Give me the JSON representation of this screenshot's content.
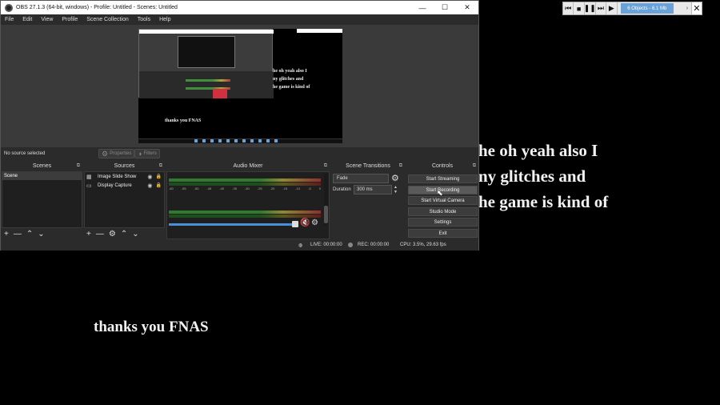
{
  "background": {
    "line1": "he oh yeah also I",
    "line2": "ny glitches and",
    "line3": "he game is kind of",
    "thanks": "thanks you FNAS"
  },
  "media_control": {
    "info": "6 Objects - 6.1 Mb"
  },
  "window": {
    "title": "OBS 27.1.3 (64-bit, windows) - Profile: Untitled - Scenes: Untitled"
  },
  "menu": [
    "File",
    "Edit",
    "View",
    "Profile",
    "Scene Collection",
    "Tools",
    "Help"
  ],
  "preview": {
    "line1": "he oh yeah also I",
    "line2": "ny glitches and",
    "line3": "he game is kind of",
    "thanks": "thanks you FNAS"
  },
  "source_bar": {
    "no_source": "No source selected",
    "properties": "Properties",
    "filters": "Filters"
  },
  "docks": {
    "scenes": "Scenes",
    "sources": "Sources",
    "audio_mixer": "Audio Mixer",
    "scene_transitions": "Scene Transitions",
    "controls": "Controls"
  },
  "scenes": [
    {
      "name": "Scene"
    }
  ],
  "sources": [
    {
      "name": "Image Slide Show"
    },
    {
      "name": "Display Capture"
    }
  ],
  "mixer": {
    "ticks": [
      "-60",
      "-55",
      "-50",
      "-45",
      "-40",
      "-35",
      "-30",
      "-25",
      "-20",
      "-15",
      "-10",
      "-5",
      "0"
    ]
  },
  "transitions": {
    "selected": "Fade",
    "duration_label": "Duration",
    "duration_value": "300 ms"
  },
  "controls": {
    "start_streaming": "Start Streaming",
    "start_recording": "Start Recording",
    "start_virtual_camera": "Start Virtual Camera",
    "studio_mode": "Studio Mode",
    "settings": "Settings",
    "exit": "Exit"
  },
  "status": {
    "live": "LIVE: 00:00:00",
    "rec": "REC: 00:00:00",
    "cpu": "CPU: 3.5%, 29.63 fps"
  },
  "colors": {
    "accent": "#4a90d9",
    "panel": "#2b2b2b",
    "mute": "#d03030"
  }
}
